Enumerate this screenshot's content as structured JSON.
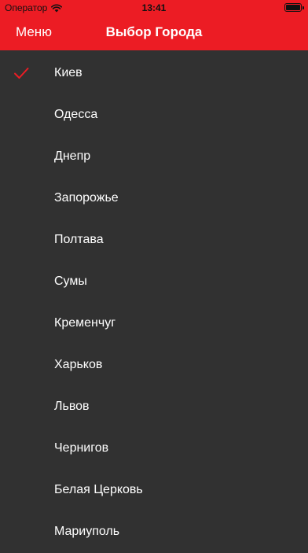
{
  "status_bar": {
    "carrier": "Оператор",
    "time": "13:41"
  },
  "nav": {
    "menu_label": "Меню",
    "title": "Выбор Города"
  },
  "accent_color": "#ec1c24",
  "selected_city": "Киев",
  "cities": [
    {
      "label": "Киев",
      "selected": true
    },
    {
      "label": "Одесса",
      "selected": false
    },
    {
      "label": "Днепр",
      "selected": false
    },
    {
      "label": "Запорожье",
      "selected": false
    },
    {
      "label": "Полтава",
      "selected": false
    },
    {
      "label": "Сумы",
      "selected": false
    },
    {
      "label": "Кременчуг",
      "selected": false
    },
    {
      "label": "Харьков",
      "selected": false
    },
    {
      "label": "Львов",
      "selected": false
    },
    {
      "label": "Чернигов",
      "selected": false
    },
    {
      "label": "Белая Церковь",
      "selected": false
    },
    {
      "label": "Мариуполь",
      "selected": false
    }
  ]
}
